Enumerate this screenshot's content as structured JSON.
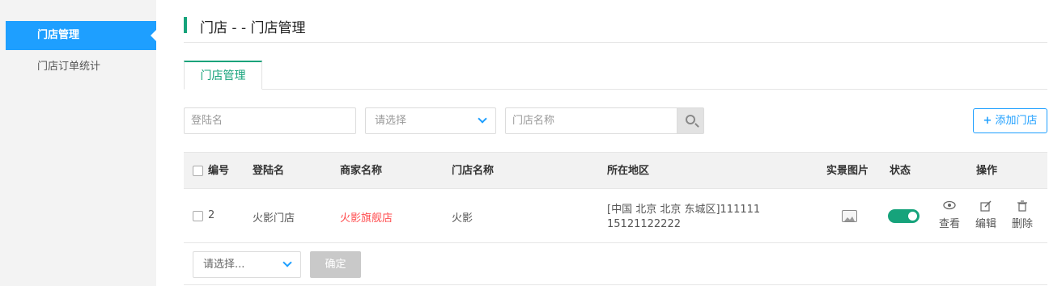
{
  "sidebar": {
    "items": [
      {
        "label": "门店管理",
        "active": true
      },
      {
        "label": "门店订单统计",
        "active": false
      }
    ]
  },
  "page": {
    "title": "门店 - - 门店管理"
  },
  "tabs": [
    {
      "label": "门店管理",
      "active": true
    }
  ],
  "filters": {
    "login_placeholder": "登陆名",
    "select_placeholder": "请选择",
    "store_name_placeholder": "门店名称",
    "add_button_label": "添加门店",
    "add_button_icon": "+"
  },
  "table": {
    "headers": {
      "id": "编号",
      "login": "登陆名",
      "merchant": "商家名称",
      "store": "门店名称",
      "region": "所在地区",
      "photo": "实景图片",
      "status": "状态",
      "actions": "操作"
    },
    "rows": [
      {
        "id": "2",
        "login": "火影门店",
        "merchant": "火影旗舰店",
        "store": "火影",
        "region_line1": "[中国  北京  北京  东城区]111111",
        "region_line2": "15121122222",
        "status_on": true,
        "view_label": "查看",
        "edit_label": "编辑",
        "delete_label": "删除"
      }
    ]
  },
  "footer": {
    "select_placeholder": "请选择...",
    "confirm_label": "确定"
  },
  "colors": {
    "accent_blue": "#1e9fff",
    "accent_green": "#16a37b",
    "merchant_red": "#ff4d4f"
  }
}
